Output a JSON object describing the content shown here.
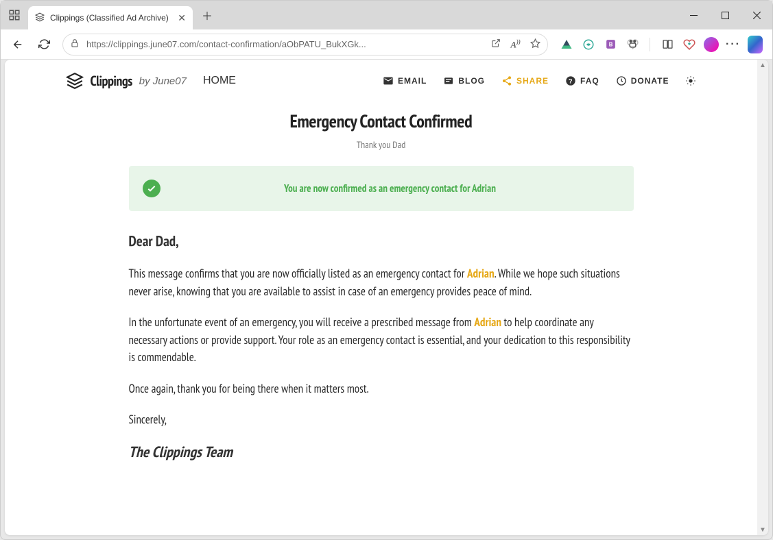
{
  "window": {
    "tab_title": "Clippings (Classified Ad Archive)",
    "url": "https://clippings.june07.com/contact-confirmation/aObPATU_BukXGk..."
  },
  "header": {
    "logo": "Clippings",
    "logo_sub": "by June07",
    "nav": {
      "home": "HOME",
      "email": "EMAIL",
      "blog": "BLOG",
      "share": "SHARE",
      "faq": "FAQ",
      "donate": "DONATE"
    }
  },
  "page": {
    "title": "Emergency Contact Confirmed",
    "subtitle": "Thank you Dad",
    "alert_prefix": "You are now confirmed as an emergency contact for ",
    "alert_name": "Adrian",
    "greeting": "Dear Dad,",
    "p1_a": "This message confirms that you are now officially listed as an emergency contact for ",
    "p1_name": "Adrian",
    "p1_b": ". While we hope such situations never arise, knowing that you are available to assist in case of an emergency provides peace of mind.",
    "p2_a": "In the unfortunate event of an emergency, you will receive a prescribed message from ",
    "p2_name": "Adrian",
    "p2_b": " to help coordinate any necessary actions or provide support. Your role as an emergency contact is essential, and your dedication to this responsibility is commendable.",
    "p3": "Once again, thank you for being there when it matters most.",
    "p4": "Sincerely,",
    "signature": "The Clippings Team"
  }
}
